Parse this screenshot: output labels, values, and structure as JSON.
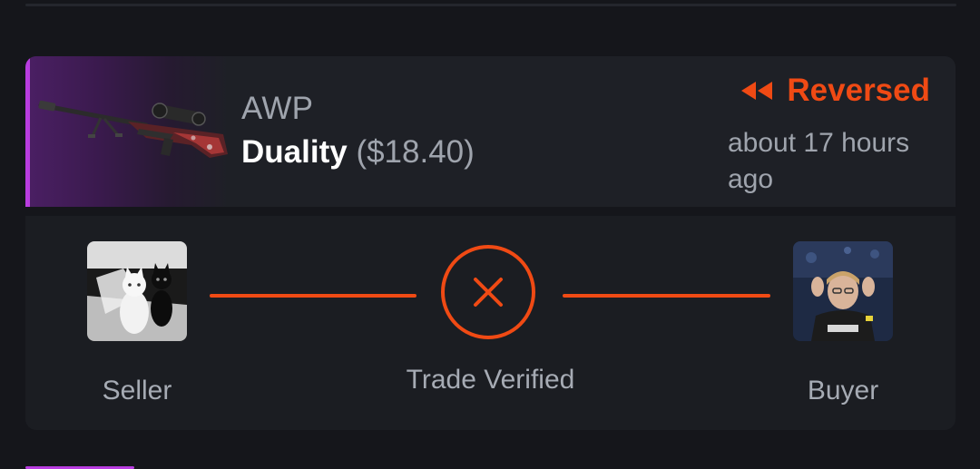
{
  "item": {
    "weapon": "AWP",
    "skin": "Duality",
    "price": "($18.40)",
    "rarity_color": "#b93de0",
    "image_icon": "awp-rifle-icon"
  },
  "status": {
    "label": "Reversed",
    "icon": "rewind-icon",
    "color": "#f04a14",
    "time_ago": "about 17 hours ago"
  },
  "trade": {
    "seller_label": "Seller",
    "buyer_label": "Buyer",
    "verification_label": "Trade Verified",
    "verification_icon": "x-close-icon",
    "line_color": "#f04a14"
  },
  "colors": {
    "background": "#15161b",
    "card": "#1b1d22",
    "accent": "#f04a14",
    "muted_text": "#9fa4ad"
  }
}
